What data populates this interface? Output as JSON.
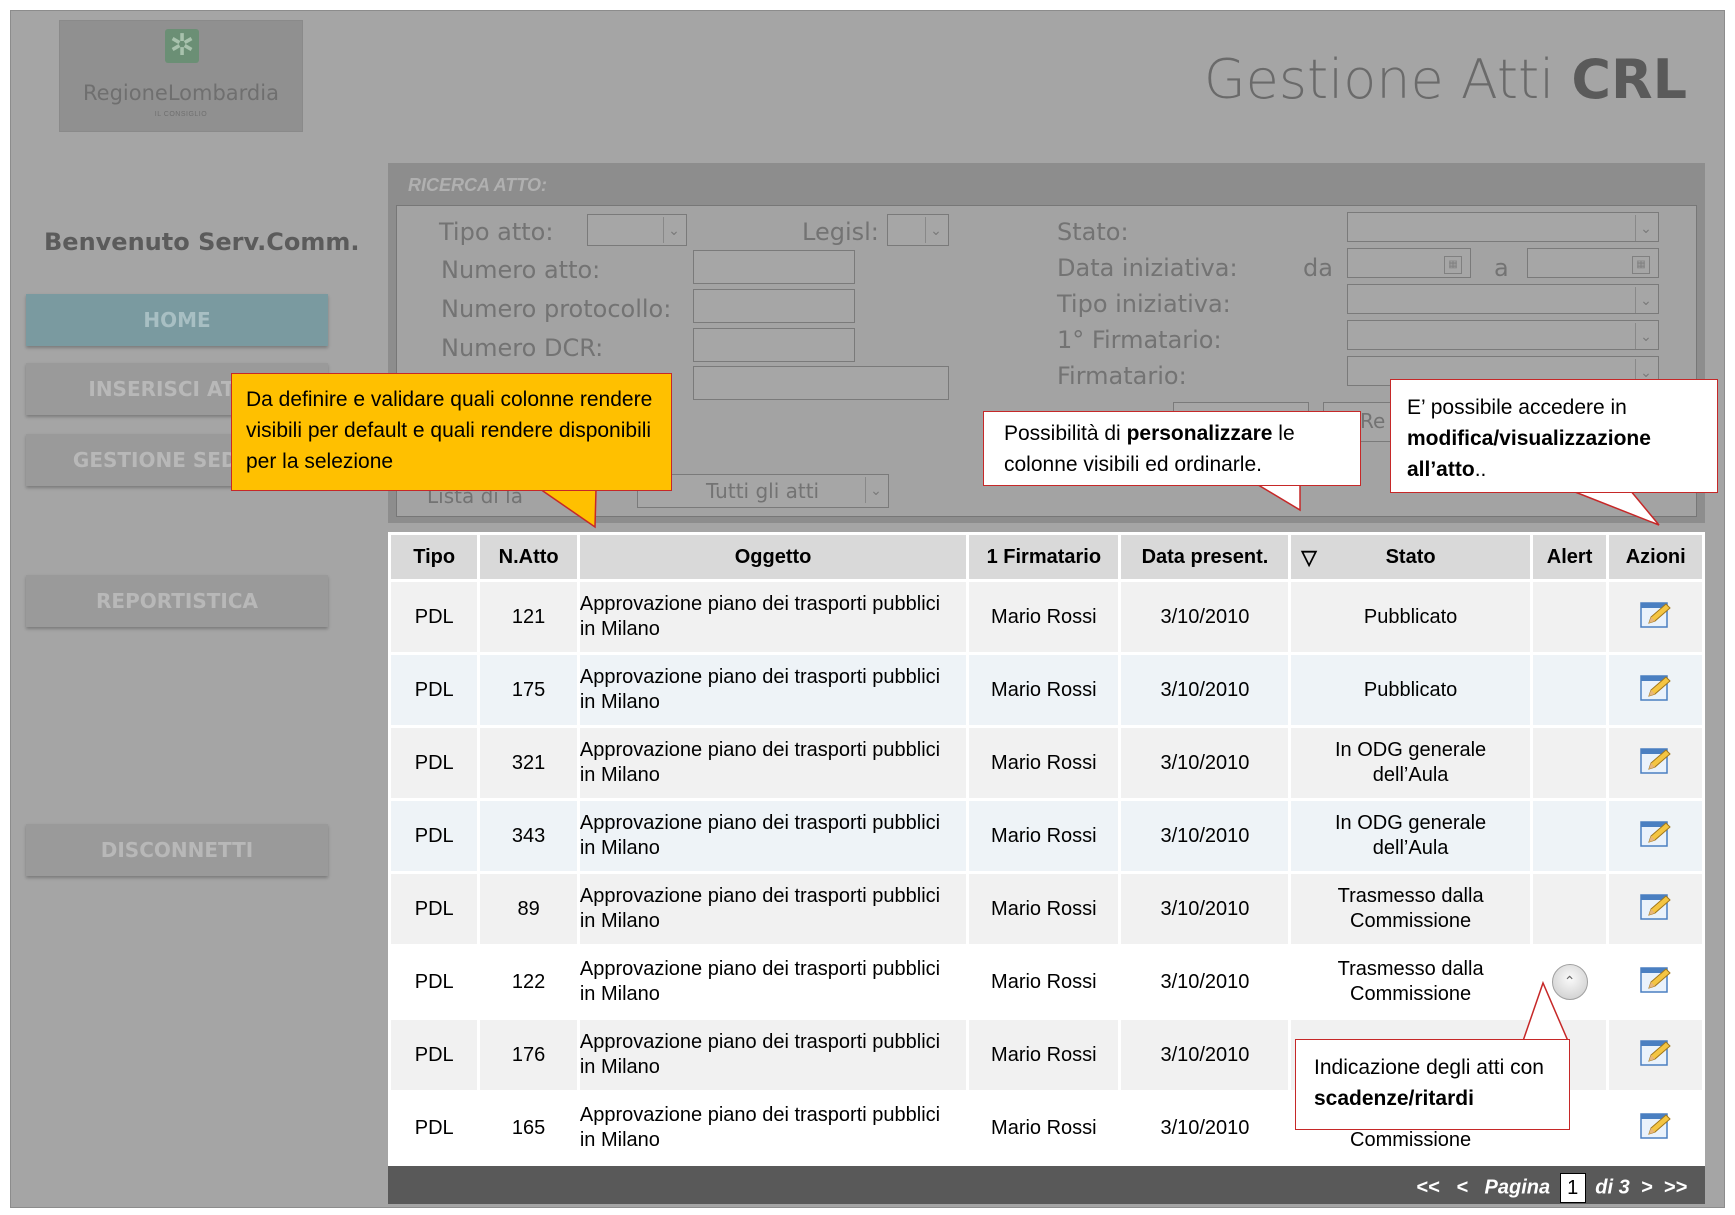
{
  "logo": {
    "text": "RegioneLombardia",
    "sub": "IL CONSIGLIO"
  },
  "app_title": {
    "prefix": "Gestione Atti ",
    "bold": "CRL"
  },
  "welcome": "Benvenuto Serv.Comm.",
  "nav": {
    "home": "HOME",
    "inserisci": "INSERISCI ATTO",
    "gestione": "GESTIONE SEDUTE",
    "report": "REPORTISTICA",
    "logout": "DISCONNETTI"
  },
  "search": {
    "title": "RICERCA ATTO:",
    "tipo_atto": "Tipo atto:",
    "legisl": "Legisl:",
    "numero_atto": "Numero atto:",
    "numero_protocollo": "Numero protocollo:",
    "numero_dcr": "Numero DCR:",
    "stato": "Stato:",
    "data_iniziativa": "Data iniziativa:",
    "da": "da",
    "a": "a",
    "tipo_iniziativa": "Tipo iniziativa:",
    "primo_firmatario": "1° Firmatario:",
    "firmatario": "Firmatario:",
    "reset_partial": "Re",
    "lista_partial": "Lista di la",
    "lista_value": "Tutti gli atti"
  },
  "table": {
    "headers": {
      "tipo": "Tipo",
      "natto": "N.Atto",
      "oggetto": "Oggetto",
      "firmatario": "1 Firmatario",
      "data": "Data present.",
      "sort_icon": "▽",
      "stato": "Stato",
      "alert": "Alert",
      "azioni": "Azioni"
    },
    "rows": [
      {
        "tipo": "PDL",
        "natto": "121",
        "oggetto_1": "Approvazione piano dei trasporti pubblici",
        "oggetto_2": "in Milano",
        "firmatario": "Mario Rossi",
        "data": "3/10/2010",
        "stato_1": "Pubblicato",
        "stato_2": ""
      },
      {
        "tipo": "PDL",
        "natto": "175",
        "oggetto_1": "Approvazione piano dei trasporti pubblici",
        "oggetto_2": "in Milano",
        "firmatario": "Mario Rossi",
        "data": "3/10/2010",
        "stato_1": "Pubblicato",
        "stato_2": ""
      },
      {
        "tipo": "PDL",
        "natto": "321",
        "oggetto_1": "Approvazione piano dei trasporti pubblici",
        "oggetto_2": "in Milano",
        "firmatario": "Mario Rossi",
        "data": "3/10/2010",
        "stato_1": "In ODG generale",
        "stato_2": "dell’Aula"
      },
      {
        "tipo": "PDL",
        "natto": "343",
        "oggetto_1": "Approvazione piano dei trasporti pubblici",
        "oggetto_2": "in Milano",
        "firmatario": "Mario Rossi",
        "data": "3/10/2010",
        "stato_1": "In ODG generale",
        "stato_2": "dell’Aula"
      },
      {
        "tipo": "PDL",
        "natto": "89",
        "oggetto_1": "Approvazione piano dei trasporti pubblici",
        "oggetto_2": "in Milano",
        "firmatario": "Mario Rossi",
        "data": "3/10/2010",
        "stato_1": "Trasmesso dalla",
        "stato_2": "Commissione"
      },
      {
        "tipo": "PDL",
        "natto": "122",
        "oggetto_1": "Approvazione piano dei trasporti pubblici",
        "oggetto_2": "in Milano",
        "firmatario": "Mario Rossi",
        "data": "3/10/2010",
        "stato_1": "Trasmesso dalla",
        "stato_2": "Commissione"
      },
      {
        "tipo": "PDL",
        "natto": "176",
        "oggetto_1": "Approvazione piano dei trasporti pubblici",
        "oggetto_2": "in Milano",
        "firmatario": "Mario Rossi",
        "data": "3/10/2010",
        "stato_1": "Trasmesso d",
        "stato_2": ""
      },
      {
        "tipo": "PDL",
        "natto": "165",
        "oggetto_1": "Approvazione piano dei trasporti pubblici",
        "oggetto_2": "in Milano",
        "firmatario": "Mario Rossi",
        "data": "3/10/2010",
        "stato_1": "",
        "stato_2": "Commissione"
      }
    ]
  },
  "pager": {
    "first": "<<",
    "prev": "<",
    "label": "Pagina",
    "current": "1",
    "of": "di 3",
    "next": ">",
    "last": ">>"
  },
  "callouts": {
    "yellow": "Da definire e validare quali colonne rendere visibili per default e quali rendere disponibili per la selezione",
    "columns_pre": "Possibilità di ",
    "columns_bold": "personalizzare",
    "columns_post": " le colonne visibili ed ordinarle.",
    "edit_pre": "E’ possibile accedere in ",
    "edit_bold": "modifica/visualizzazione all’atto",
    "edit_post": "..",
    "alert_pre": "Indicazione degli atti con ",
    "alert_bold": "scadenze/ritardi"
  },
  "colors": {
    "accent_border": "#c62828",
    "callout_yellow": "#ffc000",
    "pager_bg": "#595959",
    "home_button": "#7a9aa0"
  }
}
